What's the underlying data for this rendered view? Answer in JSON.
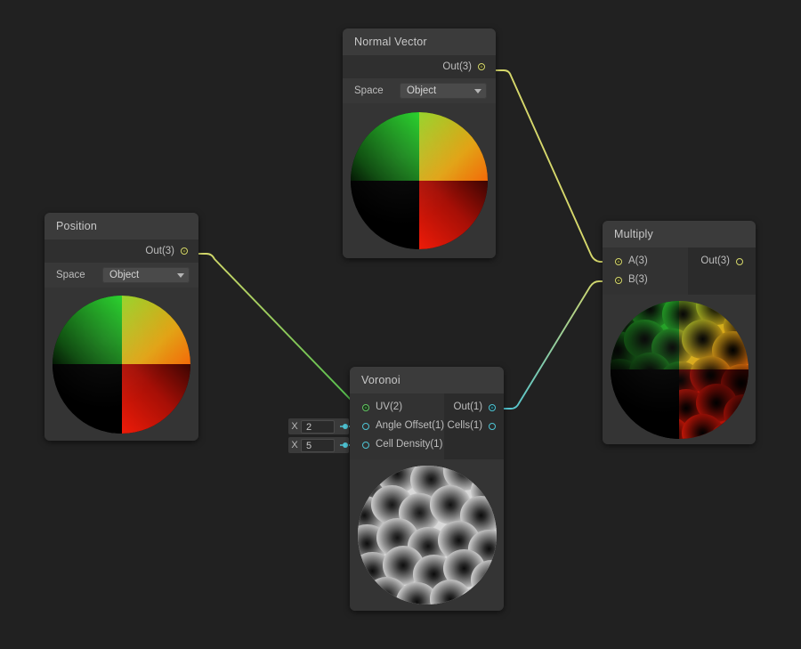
{
  "canvas": {
    "background": "#212121",
    "app": "Shader Graph"
  },
  "palette": {
    "vector3": "#d6d86b",
    "vector2": "#63c763",
    "float": "#4ec4d4",
    "node_body": "#2b2b2b",
    "node_header": "#3b3b3b",
    "port_area": "#323232",
    "control_row": "#383838",
    "preview_bg": "#343434"
  },
  "nodes": [
    {
      "id": "normal-vector",
      "title": "Normal Vector",
      "outputs": [
        {
          "label": "Out(3)",
          "type": "vector3"
        }
      ],
      "control": {
        "label": "Space",
        "value": "Object"
      },
      "preview": "quadrant-sphere"
    },
    {
      "id": "position",
      "title": "Position",
      "outputs": [
        {
          "label": "Out(3)",
          "type": "vector3"
        }
      ],
      "control": {
        "label": "Space",
        "value": "Object"
      },
      "preview": "quadrant-sphere"
    },
    {
      "id": "voronoi",
      "title": "Voronoi",
      "inputs": [
        {
          "label": "UV(2)",
          "type": "vector2",
          "connected": true
        },
        {
          "label": "Angle Offset(1)",
          "type": "float",
          "connected": false
        },
        {
          "label": "Cell Density(1)",
          "type": "float",
          "connected": false
        }
      ],
      "outputs": [
        {
          "label": "Out(1)",
          "type": "float",
          "connected": true
        },
        {
          "label": "Cells(1)",
          "type": "float",
          "connected": false
        }
      ],
      "slots": [
        {
          "axis": "X",
          "value": "2"
        },
        {
          "axis": "X",
          "value": "5"
        }
      ],
      "preview": "voronoi-sphere"
    },
    {
      "id": "multiply",
      "title": "Multiply",
      "inputs": [
        {
          "label": "A(3)",
          "type": "vector3",
          "connected": true
        },
        {
          "label": "B(3)",
          "type": "vector3",
          "connected": true
        }
      ],
      "outputs": [
        {
          "label": "Out(3)",
          "type": "vector3",
          "connected": false
        }
      ],
      "preview": "multiply-sphere"
    }
  ],
  "edges": [
    {
      "from": "position.Out(3)",
      "to": "voronoi.UV(2)",
      "from_type": "vector3",
      "to_type": "vector2"
    },
    {
      "from": "normal-vector.Out(3)",
      "to": "multiply.A(3)",
      "from_type": "vector3",
      "to_type": "vector3"
    },
    {
      "from": "voronoi.Out(1)",
      "to": "multiply.B(3)",
      "from_type": "float",
      "to_type": "vector3"
    }
  ]
}
